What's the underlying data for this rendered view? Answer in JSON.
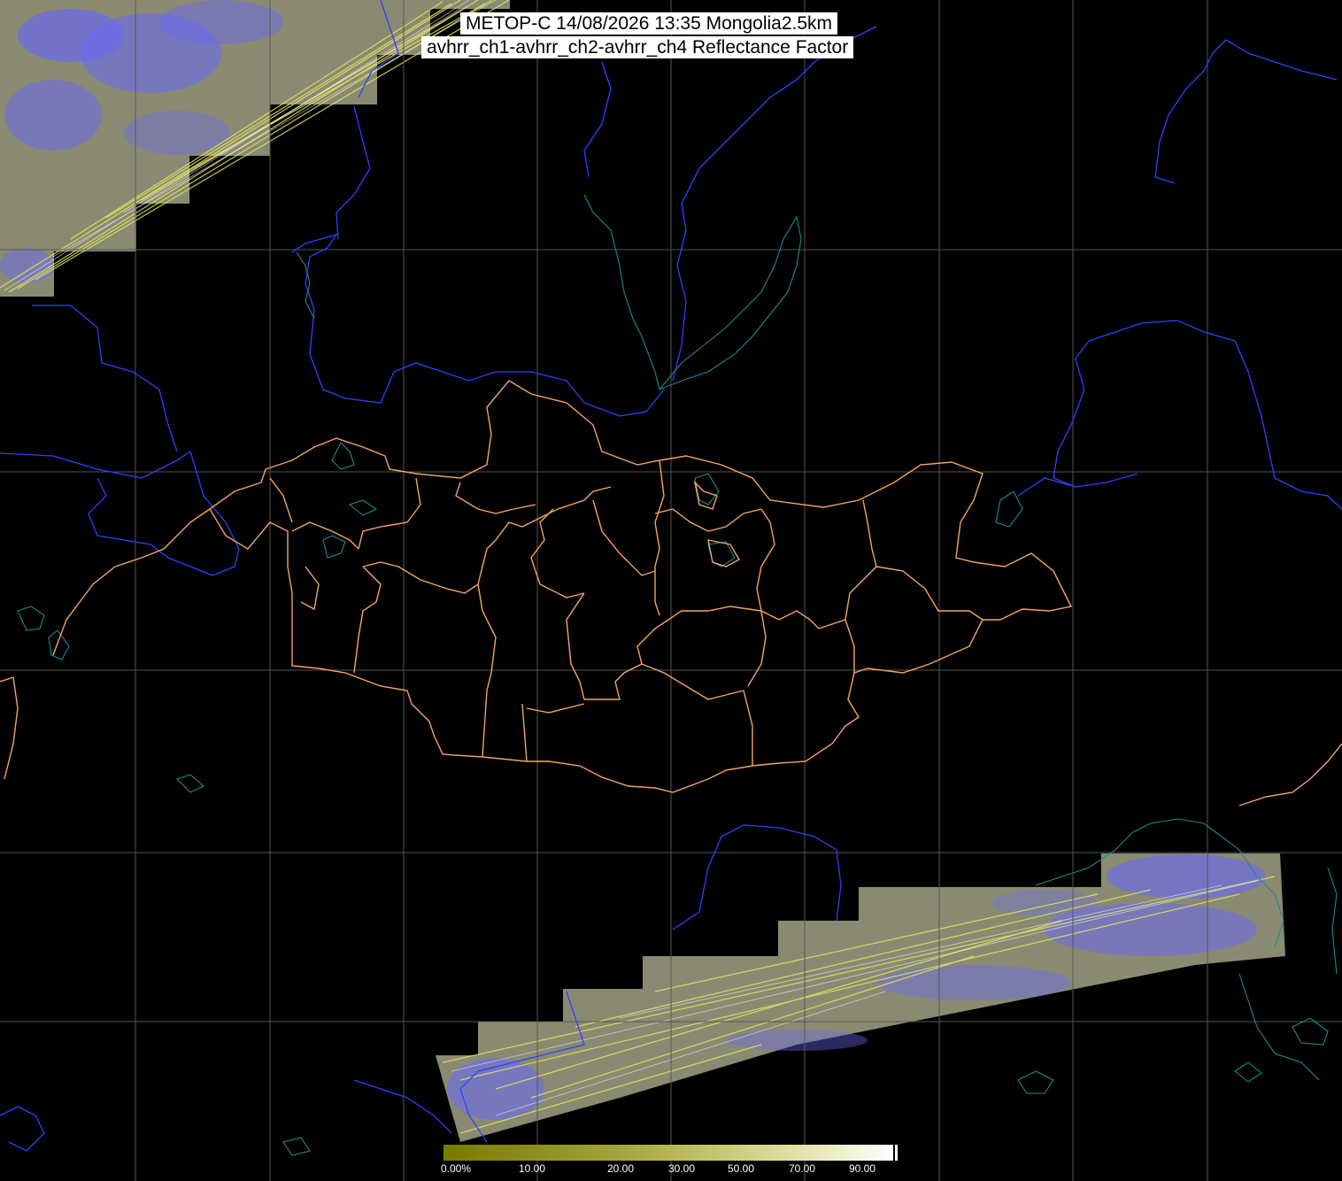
{
  "header": {
    "title_line1": "METOP-C 14/08/2026 13:35 Mongolia2.5km",
    "title_line2": "avhrr_ch1-avhrr_ch2-avhrr_ch4 Reflectance Factor"
  },
  "legend": {
    "tick_labels": [
      "0.00%",
      "10.00",
      "20.00",
      "30.00",
      "50.00",
      "70.00",
      "90.00"
    ],
    "ramp_colors": [
      "#7a7a00",
      "#8c8c1c",
      "#a3a33c",
      "#bdbd62",
      "#d4d48c",
      "#ebebc0",
      "#ffffff"
    ]
  },
  "colors": {
    "background": "#000000",
    "graticule": "#555555",
    "admin_border": "#f5a560",
    "national_border": "#2b42ff",
    "coastline": "#1f8a8a",
    "cloud_blue": "#6a6af0",
    "land_gray": "#8a8a7a"
  }
}
